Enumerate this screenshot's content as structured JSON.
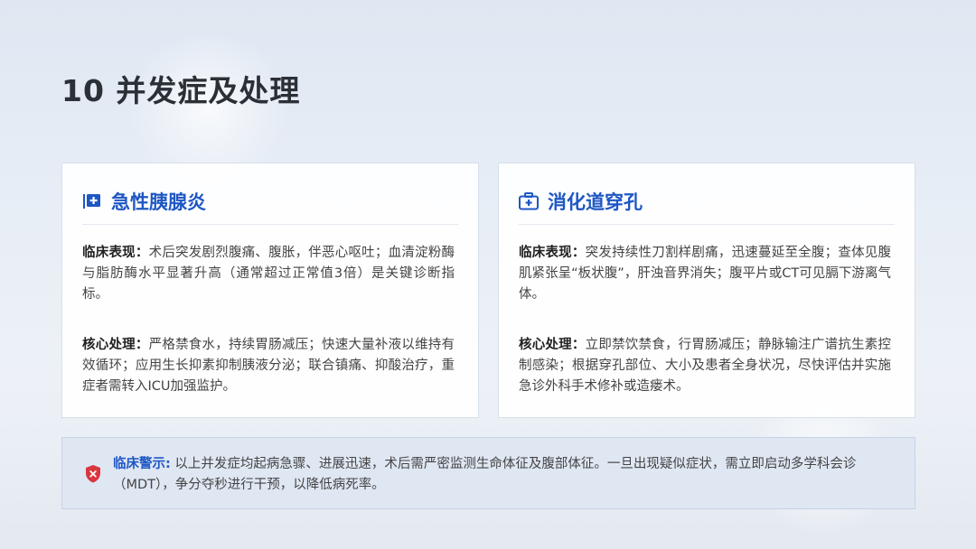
{
  "slide": {
    "title": "10 并发症及处理"
  },
  "cards": [
    {
      "title": "急性胰腺炎",
      "icon": "hospital-plus-icon",
      "sections": [
        {
          "label": "临床表现：",
          "text": "术后突发剧烈腹痛、腹胀，伴恶心呕吐；血清淀粉酶与脂肪酶水平显著升高（通常超过正常值3倍）是关键诊断指标。"
        },
        {
          "label": "核心处理：",
          "text": "严格禁食水，持续胃肠减压；快速大量补液以维持有效循环；应用生长抑素抑制胰液分泌；联合镇痛、抑酸治疗，重症者需转入ICU加强监护。"
        }
      ]
    },
    {
      "title": "消化道穿孔",
      "icon": "medical-kit-icon",
      "sections": [
        {
          "label": "临床表现：",
          "text": "突发持续性刀割样剧痛，迅速蔓延至全腹；查体见腹肌紧张呈“板状腹”，肝浊音界消失；腹平片或CT可见膈下游离气体。"
        },
        {
          "label": "核心处理：",
          "text": "立即禁饮禁食，行胃肠减压；静脉输注广谱抗生素控制感染；根据穿孔部位、大小及患者全身状况，尽快评估并实施急诊外科手术修补或造瘘术。"
        }
      ]
    }
  ],
  "warning": {
    "label": "临床警示:",
    "text": " 以上并发症均起病急骤、进展迅速，术后需严密监测生命体征及腹部体征。一旦出现疑似症状，需立即启动多学科会诊（MDT），争分夺秒进行干预，以降低病死率。",
    "icon": "shield-alert-icon"
  },
  "colors": {
    "accent": "#1e57c4",
    "warning_icon": "#d9363e",
    "title": "#2b2f36"
  }
}
